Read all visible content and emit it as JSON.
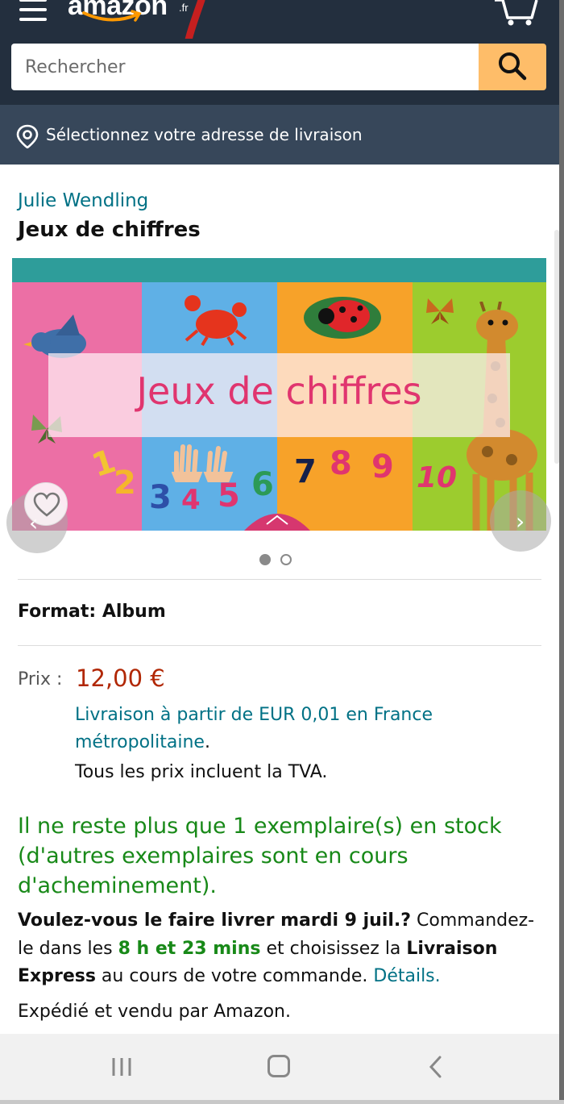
{
  "header": {
    "logo_text": "amazon",
    "logo_tld": ".fr",
    "menu_icon": "hamburger-menu-icon",
    "cart_icon": "cart-icon"
  },
  "search": {
    "placeholder": "Rechercher",
    "value": "",
    "button_icon": "search-icon"
  },
  "delivery_location": {
    "icon": "location-pin-icon",
    "label": "Sélectionnez votre adresse de livraison"
  },
  "product": {
    "author": "Julie Wendling",
    "title": "Jeux de chiffres",
    "cover": {
      "title": "Jeux de chiffres",
      "digits": [
        "1",
        "2",
        "3",
        "4",
        "5",
        "6",
        "7",
        "8",
        "9",
        "10"
      ]
    },
    "carousel": {
      "total_images": 2,
      "active_index": 0,
      "wishlist_icon": "heart-icon",
      "prev_icon": "chevron-left-icon",
      "next_icon": "chevron-right-icon"
    },
    "format_label": "Format: Album",
    "price_label": "Prix :",
    "price": "12,00 €",
    "shipping_link": "Livraison à partir de EUR 0,01 en France métropolitaine",
    "shipping_suffix": ".",
    "tva_note": "Tous les prix incluent la TVA.",
    "stock_message": "Il ne reste plus que 1 exemplaire(s) en stock (d'autres exemplaires sont en cours d'acheminement).",
    "delivery": {
      "question": "Voulez-vous le faire livrer mardi 9 juil.?",
      "order_prefix": " Commandez-le dans les ",
      "countdown": "8 h et 23 mins",
      "choose_text": " et choisissez la ",
      "express_label": "Livraison Express",
      "suffix": " au cours de votre commande. ",
      "details_link": "Détails."
    },
    "seller_info": "Expédié et vendu par Amazon."
  },
  "system_nav": {
    "recent_icon": "recent-apps-icon",
    "home_icon": "home-icon",
    "back_icon": "back-icon"
  },
  "colors": {
    "header_bg": "#232f3e",
    "subheader_bg": "#37475a",
    "search_button": "#febd69",
    "link": "#007185",
    "price": "#b12704",
    "stock": "#188918"
  }
}
